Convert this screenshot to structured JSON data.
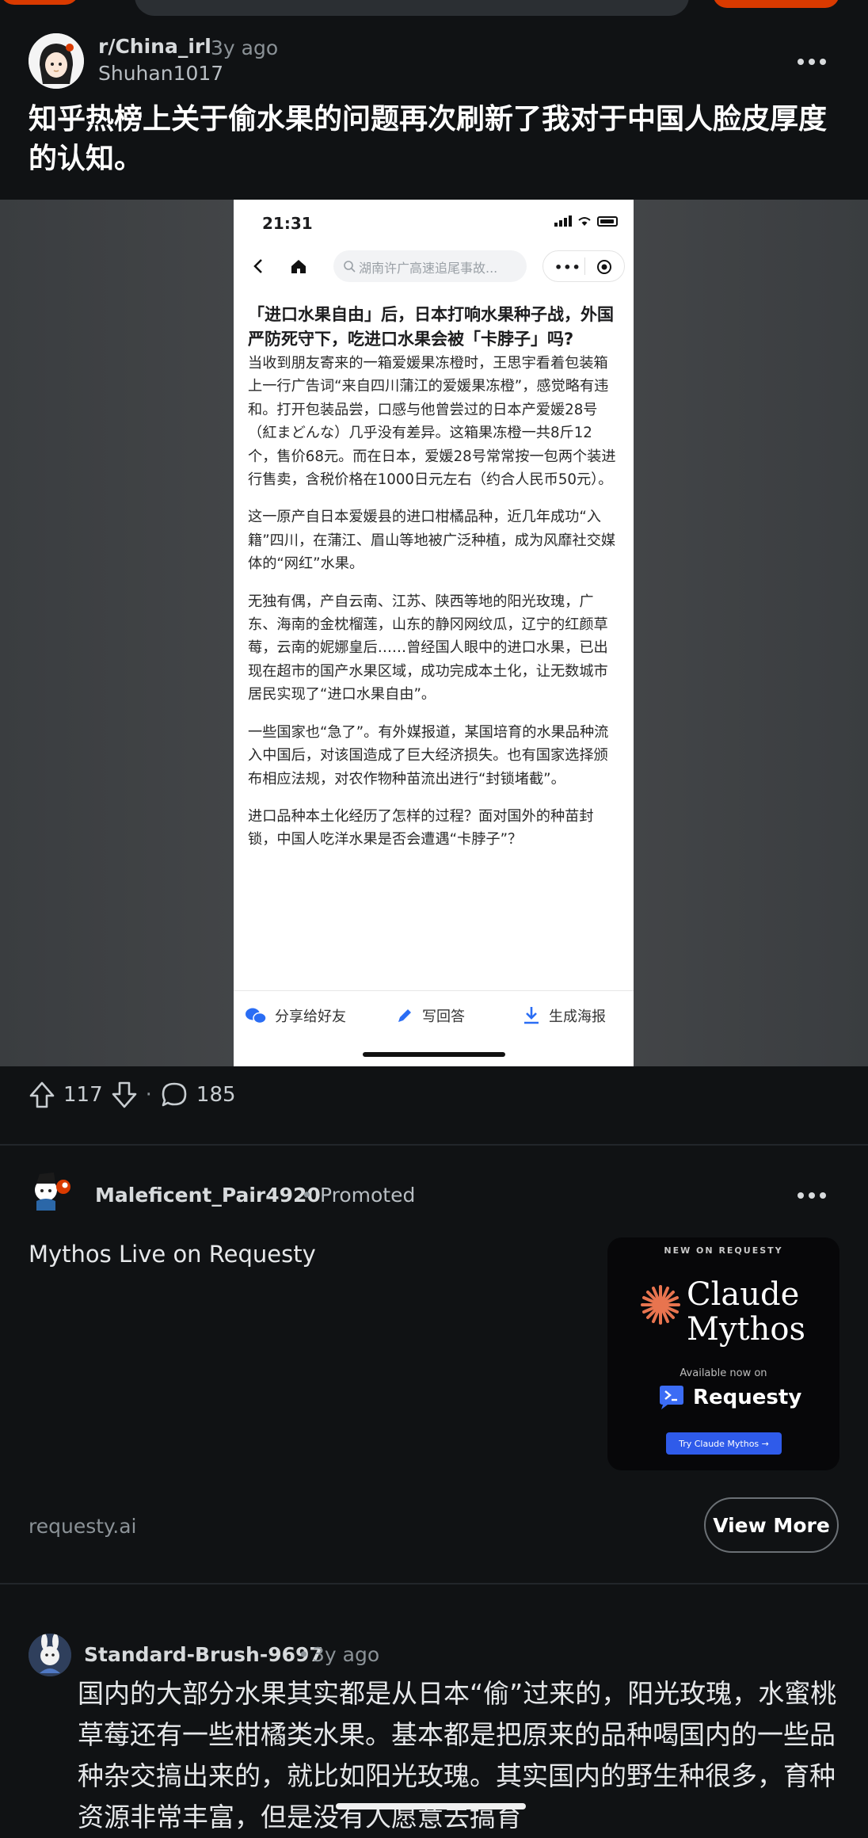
{
  "post": {
    "subreddit": "r/China_irl",
    "age": "3y ago",
    "author": "Shuhan1017",
    "title": "知乎热榜上关于偷水果的问题再次刷新了我对于中国人脸皮厚度的认知。",
    "upvotes": "117",
    "separator": "·",
    "comments": "185"
  },
  "screenshot": {
    "time": "21:31",
    "search_placeholder": "湖南许广高速追尾事故...",
    "article_title": "「进口水果自由」后，日本打响水果种子战，外国严防死守下，吃进口水果会被「卡脖子」吗?",
    "paragraphs": [
      "当收到朋友寄来的一箱爱媛果冻橙时，王思宇看着包装箱上一行广告词“来自四川蒲江的爱媛果冻橙”，感觉略有违和。打开包装品尝，口感与他曾尝过的日本产爱媛28号（紅まどんな）几乎没有差异。这箱果冻橙一共8斤12个，售价68元。而在日本，爱媛28号常常按一包两个装进行售卖，含税价格在1000日元左右（约合人民币50元）。",
      "这一原产自日本爱媛县的进口柑橘品种，近几年成功“入籍”四川，在蒲江、眉山等地被广泛种植，成为风靡社交媒体的“网红”水果。",
      "无独有偶，产自云南、江苏、陕西等地的阳光玫瑰，广东、海南的金枕榴莲，山东的静冈网纹瓜，辽宁的红颜草莓，云南的妮娜皇后……曾经国人眼中的进口水果，已出现在超市的国产水果区域，成功完成本土化，让无数城市居民实现了“进口水果自由”。",
      "一些国家也“急了”。有外媒报道，某国培育的水果品种流入中国后，对该国造成了巨大经济损失。也有国家选择颁布相应法规，对农作物种苗流出进行“封锁堵截”。",
      "进口品种本土化经历了怎样的过程？面对国外的种苗封锁，中国人吃洋水果是否会遭遇“卡脖子”？"
    ],
    "actions": [
      "分享给好友",
      "写回答",
      "生成海报"
    ]
  },
  "ad": {
    "author": "Maleficent_Pair4920",
    "dot": "•",
    "label": "Promoted",
    "headline": "Mythos Live on Requesty",
    "creative_kicker": "NEW ON REQUESTY",
    "creative_brand_line1": "Claude",
    "creative_brand_line2": "Mythos",
    "creative_available": "Available now on",
    "creative_requesty": "Requesty",
    "creative_cta": "Try Claude Mythos →",
    "domain": "requesty.ai",
    "view_more": "View More"
  },
  "comment": {
    "author": "Standard-Brush-9697",
    "dot": "•",
    "age": "3y ago",
    "body": "国内的大部分水果其实都是从日本“偷”过来的，阳光玫瑰，水蜜桃草莓还有一些柑橘类水果。基本都是把原来的品种喝国内的一些品种杂交搞出来的，就比如阳光玫瑰。其实国内的野生种很多，育种资源非常丰富，但是没有人愿意去搞育"
  },
  "colors": {
    "background": "#101214",
    "accent": "#d93a00",
    "cta_blue": "#2f5bea",
    "phone_icon_blue": "#2a6df4"
  }
}
